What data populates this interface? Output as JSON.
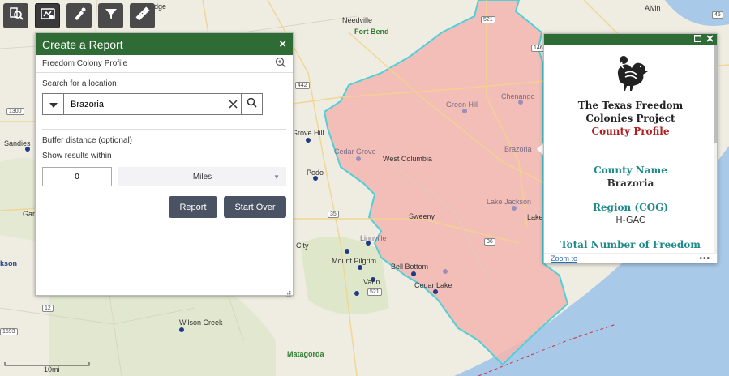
{
  "map": {
    "places": [
      {
        "name": "Sandies",
        "style": "normal"
      },
      {
        "name": "Needville",
        "style": "normal"
      },
      {
        "name": "Fort Bend",
        "style": "green"
      },
      {
        "name": "Grove Hill",
        "style": "normal"
      },
      {
        "name": "Podo",
        "style": "normal"
      },
      {
        "name": "Green Hill",
        "style": "muted"
      },
      {
        "name": "Chenango",
        "style": "muted"
      },
      {
        "name": "Brazoria",
        "style": "muted"
      },
      {
        "name": "Cedar Grove",
        "style": "muted"
      },
      {
        "name": "West Columbia",
        "style": "normal"
      },
      {
        "name": "Lake Jackson",
        "style": "muted"
      },
      {
        "name": "Sweeny",
        "style": "normal"
      },
      {
        "name": "Linnville",
        "style": "muted"
      },
      {
        "name": "Mount Pilgrim",
        "style": "normal"
      },
      {
        "name": "Bell Bottom",
        "style": "normal"
      },
      {
        "name": "Cedar Lake",
        "style": "normal"
      },
      {
        "name": "Vann",
        "style": "normal"
      },
      {
        "name": "Wilson Creek",
        "style": "normal"
      },
      {
        "name": "Matagorda",
        "style": "green"
      },
      {
        "name": "City",
        "style": "normal"
      },
      {
        "name": "Gar",
        "style": "normal"
      },
      {
        "name": "kson",
        "style": "blue"
      },
      {
        "name": "Lake",
        "style": "normal"
      },
      {
        "name": "Alvin",
        "style": "normal"
      },
      {
        "name": "dge",
        "style": "normal"
      }
    ],
    "road_shields": [
      "1300",
      "442",
      "521",
      "35",
      "36",
      "521",
      "12",
      "1593",
      "45",
      "521",
      "1462"
    ],
    "scale_label": "10mi",
    "county_fill": "#f4b6b0",
    "county_border": "#4fd0d8",
    "water_color": "#a9c9e8"
  },
  "toolbar": {
    "tools": [
      {
        "name": "identify-tool",
        "icon": "search-location-icon"
      },
      {
        "name": "report-tool",
        "icon": "report-map-icon"
      },
      {
        "name": "draw-tool",
        "icon": "pen-pin-icon"
      },
      {
        "name": "filter-tool",
        "icon": "funnel-icon"
      },
      {
        "name": "measure-tool",
        "icon": "ruler-icon"
      }
    ]
  },
  "report_panel": {
    "title": "Create a Report",
    "close": "×",
    "profile": "Freedom Colony Profile",
    "search_label": "Search for a location",
    "search_value": "Brazoria",
    "buffer_label": "Buffer distance (optional)",
    "show_within": "Show results within",
    "buffer_value": "0",
    "unit": "Miles",
    "report_button": "Report",
    "start_over_button": "Start Over"
  },
  "popup": {
    "title_line1": "The Texas Freedom",
    "title_line2": "Colonies Project",
    "subtitle": "County Profile",
    "county_name_label": "County Name",
    "county_name_value": "Brazoria",
    "region_label": "Region (COG)",
    "region_value": "H-GAC",
    "total_label": "Total Number of Freedom",
    "zoom_to": "Zoom to",
    "more": "•••",
    "accent_color": "#1f8a8a",
    "subtitle_color": "#b01e1e"
  }
}
